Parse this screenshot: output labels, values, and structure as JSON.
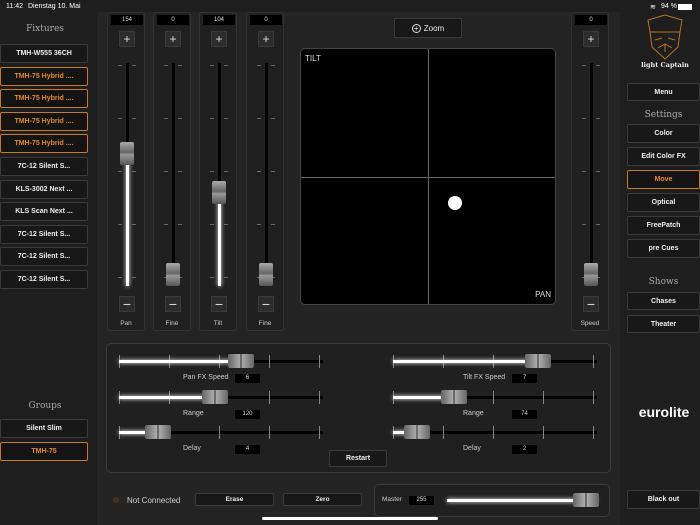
{
  "status": {
    "time": "11:42",
    "date": "Dienstag 10. Mai",
    "battery": "94 %"
  },
  "left": {
    "fixtures_title": "Fixtures",
    "fixtures": [
      {
        "label": "TMH-W555 36CH",
        "selected": false
      },
      {
        "label": "TMH-75 Hybrid ....",
        "selected": true
      },
      {
        "label": "TMH-75 Hybrid ....",
        "selected": true
      },
      {
        "label": "TMH-75 Hybrid ....",
        "selected": true
      },
      {
        "label": "TMH-75 Hybrid ....",
        "selected": true
      },
      {
        "label": "7C-12 Silent S...",
        "selected": false
      },
      {
        "label": "KLS-3002 Next ...",
        "selected": false
      },
      {
        "label": "KLS Scan Next ...",
        "selected": false
      },
      {
        "label": "7C-12 Silent S...",
        "selected": false
      },
      {
        "label": "7C-12 Silent S...",
        "selected": false
      },
      {
        "label": "7C-12 Silent S...",
        "selected": false
      }
    ],
    "groups_title": "Groups",
    "groups": [
      {
        "label": "Silent Slim",
        "selected": false
      },
      {
        "label": "TMH-75",
        "selected": true
      }
    ]
  },
  "faders": [
    {
      "label": "Pan",
      "value": 154
    },
    {
      "label": "Fine",
      "value": 0
    },
    {
      "label": "Tilt",
      "value": 104
    },
    {
      "label": "Fine",
      "value": 0
    },
    {
      "label": "Speed",
      "value": 0
    }
  ],
  "zoom_label": "Zoom",
  "xy": {
    "tilt_label": "TILT",
    "pan_label": "PAN",
    "point_x": 0.6,
    "point_y": 0.6
  },
  "fx": {
    "restart": "Restart",
    "sliders": [
      {
        "label": "Pan FX Speed",
        "value": "6",
        "fraction": 0.6
      },
      {
        "label": "Range",
        "value": "120",
        "fraction": 0.47
      },
      {
        "label": "Delay",
        "value": "4",
        "fraction": 0.19
      },
      {
        "label": "Tilt FX Speed",
        "value": "7",
        "fraction": 0.71
      },
      {
        "label": "Range",
        "value": "74",
        "fraction": 0.3
      },
      {
        "label": "Delay",
        "value": "2",
        "fraction": 0.12
      }
    ]
  },
  "bottom": {
    "connection": "Not Connected",
    "erase": "Erase",
    "zero": "Zero",
    "master_label": "Master",
    "master_value": "255",
    "master_fraction": 1.0
  },
  "right": {
    "logo_text": "light Captain",
    "menu": "Menu",
    "settings_title": "Settings",
    "settings": [
      {
        "label": "Color",
        "selected": false
      },
      {
        "label": "Edit Color FX",
        "selected": false
      },
      {
        "label": "Move",
        "selected": true
      },
      {
        "label": "Optical",
        "selected": false
      },
      {
        "label": "FreePatch",
        "selected": false
      },
      {
        "label": "pre Cues",
        "selected": false
      }
    ],
    "shows_title": "Shows",
    "shows": [
      "Chases",
      "Theater"
    ],
    "brand": "eurolite",
    "blackout": "Black out"
  },
  "colors": {
    "accent": "#e08a30"
  }
}
